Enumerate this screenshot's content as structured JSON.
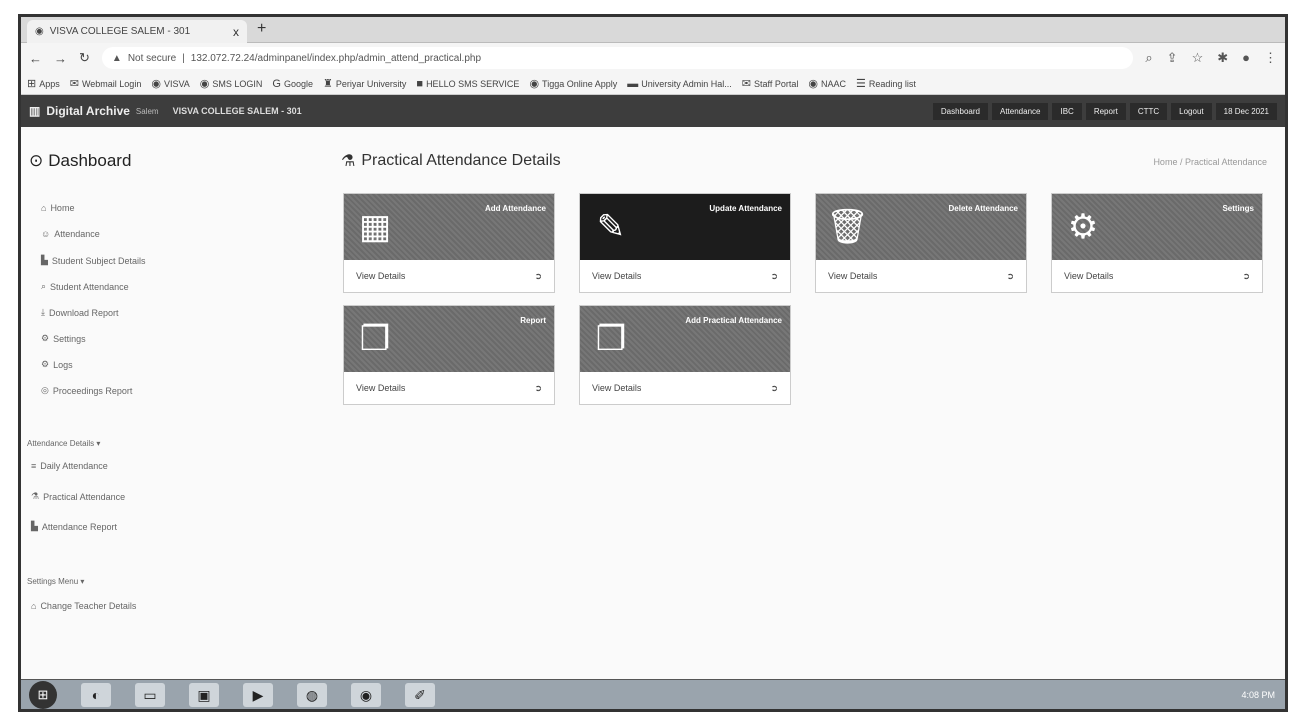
{
  "browser": {
    "tab_title": "VISVA COLLEGE SALEM - 301",
    "tab_close": "x",
    "new_tab": "+",
    "security": "Not secure",
    "url": "132.072.72.24/adminpanel/index.php/admin_attend_practical.php",
    "bookmarks": [
      "Apps",
      "Webmail Login",
      "VISVA",
      "SMS LOGIN",
      "Google",
      "Periyar University",
      "HELLO SMS SERVICE",
      "Tigga Online Apply",
      "University Admin Hal...",
      "Staff Portal",
      "NAAC",
      "Reading list"
    ]
  },
  "navbar": {
    "brand": "Digital Archive",
    "brand_sub": "Salem",
    "college": "VISVA COLLEGE SALEM - 301",
    "menu": [
      "Dashboard",
      "Attendance",
      "IBC",
      "Report",
      "CTTC",
      "Logout",
      "18 Dec 2021"
    ]
  },
  "sidebar": {
    "title": "Dashboard",
    "items": [
      "Home",
      "Attendance",
      "Student Subject Details",
      "Student Attendance",
      "Download Report",
      "Settings",
      "Logs",
      "Proceedings Report"
    ],
    "section1_label": "Attendance Details",
    "section1_items": [
      "Daily Attendance",
      "Practical Attendance",
      "Attendance Report"
    ],
    "section2_label": "Settings Menu",
    "section2_items": [
      "Change Teacher Details"
    ]
  },
  "content": {
    "title": "Practical Attendance Details",
    "breadcrumb": "Home / Practical Attendance",
    "cards": [
      {
        "title": "Add Attendance",
        "footer": "View Details",
        "icon": "calendar-icon"
      },
      {
        "title": "Update Attendance",
        "footer": "View Details",
        "icon": "edit-icon"
      },
      {
        "title": "Delete Attendance",
        "footer": "View Details",
        "icon": "trash-icon"
      },
      {
        "title": "Settings",
        "footer": "View Details",
        "icon": "gears-icon"
      },
      {
        "title": "Report",
        "footer": "View Details",
        "icon": "document-icon"
      },
      {
        "title": "Add Practical Attendance",
        "footer": "View Details",
        "icon": "document-icon"
      }
    ]
  },
  "taskbar": {
    "clock": "4:08 PM"
  }
}
